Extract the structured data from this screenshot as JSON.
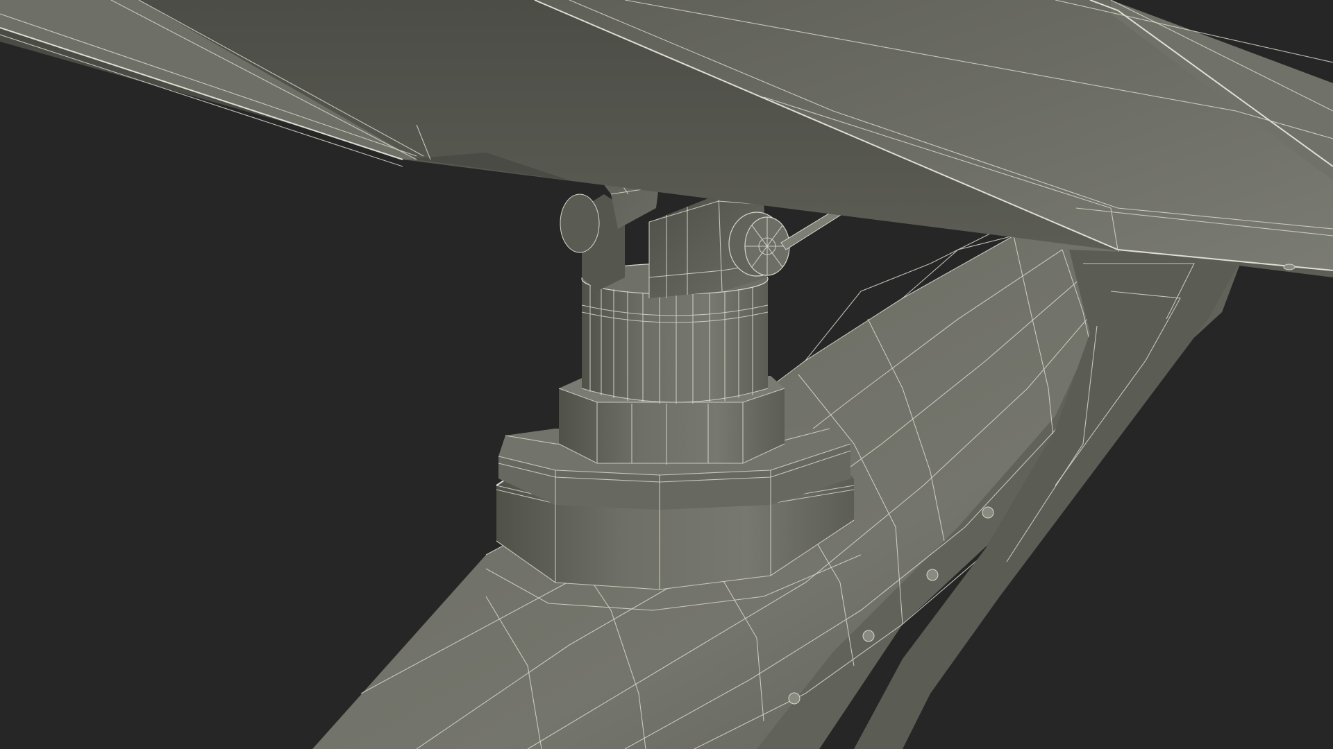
{
  "scene": {
    "background_color": "#262626",
    "surface_color": "#6e6f66",
    "wire_color": "#d8d8cc",
    "subject": "wireframe-3d-model"
  }
}
